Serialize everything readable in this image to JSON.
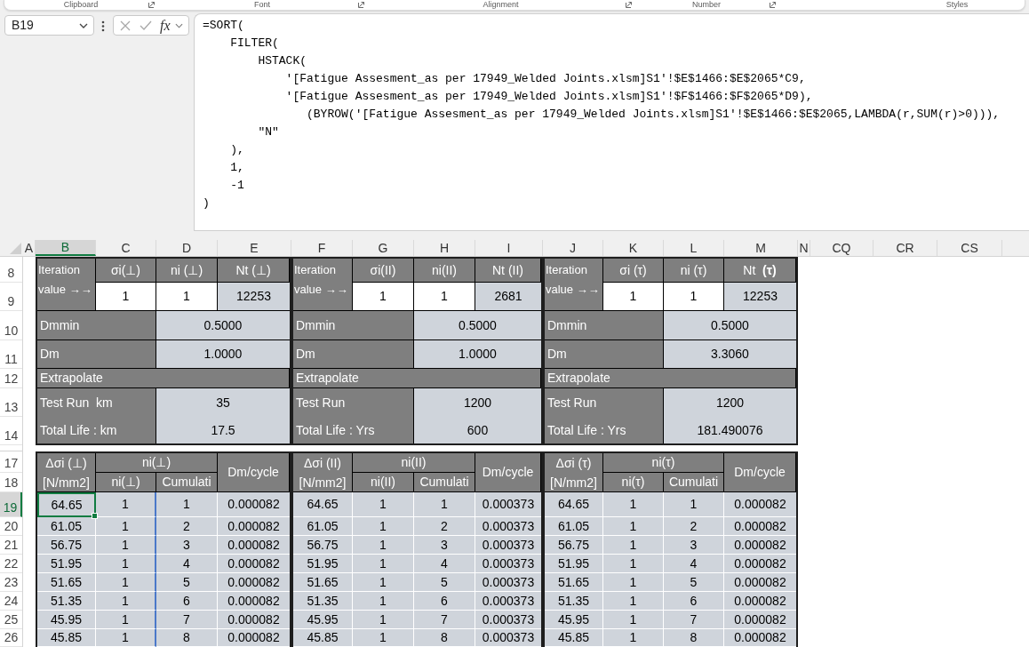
{
  "ribbon": {
    "groups": [
      {
        "label": "Clipboard",
        "launcher": true
      },
      {
        "label": "Font",
        "launcher": true
      },
      {
        "label": "Alignment",
        "launcher": true
      },
      {
        "label": "Number",
        "launcher": true
      },
      {
        "label": "Styles",
        "launcher": false
      }
    ]
  },
  "formula_bar": {
    "name_box": "B19",
    "function_button": "fx",
    "formula_lines": [
      "=SORT(",
      "    FILTER(",
      "        HSTACK(",
      "            '[Fatigue Assesment_as per 17949_Welded Joints.xlsm]S1'!$E$1466:$E$2065*C9,",
      "            '[Fatigue Assesment_as per 17949_Welded Joints.xlsm]S1'!$F$1466:$F$2065*D9),",
      "               (BYROW('[Fatigue Assesment_as per 17949_Welded Joints.xlsm]S1'!$E$1466:$E$2065,LAMBDA(r,SUM(r)>0))),",
      "        \"N\"",
      "    ),",
      "    1,",
      "    -1",
      ")"
    ]
  },
  "column_headers": [
    {
      "label": "A",
      "selected": false
    },
    {
      "label": "B",
      "selected": true
    },
    {
      "label": "C",
      "selected": false
    },
    {
      "label": "D",
      "selected": false
    },
    {
      "label": "E",
      "selected": false
    },
    {
      "label": "F",
      "selected": false
    },
    {
      "label": "G",
      "selected": false
    },
    {
      "label": "H",
      "selected": false
    },
    {
      "label": "I",
      "selected": false
    },
    {
      "label": "J",
      "selected": false
    },
    {
      "label": "K",
      "selected": false
    },
    {
      "label": "L",
      "selected": false
    },
    {
      "label": "M",
      "selected": false
    },
    {
      "label": "N",
      "selected": false
    },
    {
      "label": "CQ",
      "selected": false
    },
    {
      "label": "CR",
      "selected": false
    },
    {
      "label": "CS",
      "selected": false
    }
  ],
  "row_headers": [
    {
      "label": "8",
      "selected": false
    },
    {
      "label": "9",
      "selected": false
    },
    {
      "label": "10",
      "selected": false
    },
    {
      "label": "11",
      "selected": false
    },
    {
      "label": "12",
      "selected": false
    },
    {
      "label": "13",
      "selected": false
    },
    {
      "label": "14",
      "selected": false
    },
    {
      "label": "17",
      "selected": false
    },
    {
      "label": "18",
      "selected": false
    },
    {
      "label": "19",
      "selected": true
    },
    {
      "label": "20",
      "selected": false
    },
    {
      "label": "21",
      "selected": false
    },
    {
      "label": "22",
      "selected": false
    },
    {
      "label": "23",
      "selected": false
    },
    {
      "label": "24",
      "selected": false
    },
    {
      "label": "25",
      "selected": false
    },
    {
      "label": "26",
      "selected": false
    }
  ],
  "summary_blocks": [
    {
      "iteration_label": "Iteration value →→",
      "headers": [
        "σi(⊥)",
        "ni (⊥)",
        "Nt (⊥)"
      ],
      "inputs": [
        "1",
        "1"
      ],
      "result": "12253",
      "damage_rows": [
        {
          "label": "Dmmin",
          "value": "0.5000"
        },
        {
          "label": "Dm",
          "value": "1.0000"
        }
      ],
      "section_label": "Extrapolate",
      "extrapolation_rows": [
        {
          "label": "Test Run  km",
          "value": "35"
        },
        {
          "label": "Total Life : km",
          "value": "17.5"
        }
      ]
    },
    {
      "iteration_label": "Iteration value →→",
      "headers": [
        "σi(II)",
        "ni(II)",
        "Nt (II)"
      ],
      "inputs": [
        "1",
        "1"
      ],
      "result": "2681",
      "damage_rows": [
        {
          "label": "Dmmin",
          "value": "0.5000"
        },
        {
          "label": "Dm",
          "value": "1.0000"
        }
      ],
      "section_label": "Extrapolate",
      "extrapolation_rows": [
        {
          "label": "Test Run",
          "value": "1200"
        },
        {
          "label": "Total Life : Yrs",
          "value": "600"
        }
      ]
    },
    {
      "iteration_label": "Iteration value →→",
      "headers": [
        "σi (τ)",
        "ni (τ)",
        "Nt  **(τ)**"
      ],
      "inputs": [
        "1",
        "1"
      ],
      "result": "12253",
      "damage_rows": [
        {
          "label": "Dmmin",
          "value": "0.5000"
        },
        {
          "label": "Dm",
          "value": "3.3060"
        }
      ],
      "section_label": "Extrapolate",
      "extrapolation_rows": [
        {
          "label": "Test Run",
          "value": "1200"
        },
        {
          "label": "Total Life : Yrs",
          "value": "181.490076"
        }
      ]
    }
  ],
  "cycle_tables": [
    {
      "value_header": "Δσi (⊥) [N/mm2]",
      "count_header": "ni(⊥)",
      "sub_headers": [
        "ni(⊥)",
        "Cumulati"
      ],
      "damage_header": "Dm/cycle",
      "spill_range": true,
      "rows": [
        [
          {
            "text": "64.65",
            "selected": true
          },
          {
            "text": "1",
            "selected": false
          },
          {
            "text": "1",
            "selected": false
          },
          {
            "text": "0.000082",
            "selected": false
          }
        ],
        [
          {
            "text": "61.05",
            "selected": false
          },
          {
            "text": "1",
            "selected": false
          },
          {
            "text": "2",
            "selected": false
          },
          {
            "text": "0.000082",
            "selected": false
          }
        ],
        [
          {
            "text": "56.75",
            "selected": false
          },
          {
            "text": "1",
            "selected": false
          },
          {
            "text": "3",
            "selected": false
          },
          {
            "text": "0.000082",
            "selected": false
          }
        ],
        [
          {
            "text": "51.95",
            "selected": false
          },
          {
            "text": "1",
            "selected": false
          },
          {
            "text": "4",
            "selected": false
          },
          {
            "text": "0.000082",
            "selected": false
          }
        ],
        [
          {
            "text": "51.65",
            "selected": false
          },
          {
            "text": "1",
            "selected": false
          },
          {
            "text": "5",
            "selected": false
          },
          {
            "text": "0.000082",
            "selected": false
          }
        ],
        [
          {
            "text": "51.35",
            "selected": false
          },
          {
            "text": "1",
            "selected": false
          },
          {
            "text": "6",
            "selected": false
          },
          {
            "text": "0.000082",
            "selected": false
          }
        ],
        [
          {
            "text": "45.95",
            "selected": false
          },
          {
            "text": "1",
            "selected": false
          },
          {
            "text": "7",
            "selected": false
          },
          {
            "text": "0.000082",
            "selected": false
          }
        ],
        [
          {
            "text": "45.85",
            "selected": false
          },
          {
            "text": "1",
            "selected": false
          },
          {
            "text": "8",
            "selected": false
          },
          {
            "text": "0.000082",
            "selected": false
          }
        ]
      ]
    },
    {
      "value_header": "Δσi (II) [N/mm2]",
      "count_header": "ni(II)",
      "sub_headers": [
        "ni(II)",
        "Cumulati"
      ],
      "damage_header": "Dm/cycle",
      "spill_range": false,
      "rows": [
        [
          {
            "text": "64.65",
            "selected": false
          },
          {
            "text": "1",
            "selected": false
          },
          {
            "text": "1",
            "selected": false
          },
          {
            "text": "0.000373",
            "selected": false
          }
        ],
        [
          {
            "text": "61.05",
            "selected": false
          },
          {
            "text": "1",
            "selected": false
          },
          {
            "text": "2",
            "selected": false
          },
          {
            "text": "0.000373",
            "selected": false
          }
        ],
        [
          {
            "text": "56.75",
            "selected": false
          },
          {
            "text": "1",
            "selected": false
          },
          {
            "text": "3",
            "selected": false
          },
          {
            "text": "0.000373",
            "selected": false
          }
        ],
        [
          {
            "text": "51.95",
            "selected": false
          },
          {
            "text": "1",
            "selected": false
          },
          {
            "text": "4",
            "selected": false
          },
          {
            "text": "0.000373",
            "selected": false
          }
        ],
        [
          {
            "text": "51.65",
            "selected": false
          },
          {
            "text": "1",
            "selected": false
          },
          {
            "text": "5",
            "selected": false
          },
          {
            "text": "0.000373",
            "selected": false
          }
        ],
        [
          {
            "text": "51.35",
            "selected": false
          },
          {
            "text": "1",
            "selected": false
          },
          {
            "text": "6",
            "selected": false
          },
          {
            "text": "0.000373",
            "selected": false
          }
        ],
        [
          {
            "text": "45.95",
            "selected": false
          },
          {
            "text": "1",
            "selected": false
          },
          {
            "text": "7",
            "selected": false
          },
          {
            "text": "0.000373",
            "selected": false
          }
        ],
        [
          {
            "text": "45.85",
            "selected": false
          },
          {
            "text": "1",
            "selected": false
          },
          {
            "text": "8",
            "selected": false
          },
          {
            "text": "0.000373",
            "selected": false
          }
        ]
      ]
    },
    {
      "value_header": "Δσi (τ) [N/mm2]",
      "count_header": "ni(τ)",
      "sub_headers": [
        "ni(τ)",
        "Cumulati"
      ],
      "damage_header": "Dm/cycle",
      "spill_range": false,
      "rows": [
        [
          {
            "text": "64.65",
            "selected": false
          },
          {
            "text": "1",
            "selected": false
          },
          {
            "text": "1",
            "selected": false
          },
          {
            "text": "0.000082",
            "selected": false
          }
        ],
        [
          {
            "text": "61.05",
            "selected": false
          },
          {
            "text": "1",
            "selected": false
          },
          {
            "text": "2",
            "selected": false
          },
          {
            "text": "0.000082",
            "selected": false
          }
        ],
        [
          {
            "text": "56.75",
            "selected": false
          },
          {
            "text": "1",
            "selected": false
          },
          {
            "text": "3",
            "selected": false
          },
          {
            "text": "0.000082",
            "selected": false
          }
        ],
        [
          {
            "text": "51.95",
            "selected": false
          },
          {
            "text": "1",
            "selected": false
          },
          {
            "text": "4",
            "selected": false
          },
          {
            "text": "0.000082",
            "selected": false
          }
        ],
        [
          {
            "text": "51.65",
            "selected": false
          },
          {
            "text": "1",
            "selected": false
          },
          {
            "text": "5",
            "selected": false
          },
          {
            "text": "0.000082",
            "selected": false
          }
        ],
        [
          {
            "text": "51.35",
            "selected": false
          },
          {
            "text": "1",
            "selected": false
          },
          {
            "text": "6",
            "selected": false
          },
          {
            "text": "0.000082",
            "selected": false
          }
        ],
        [
          {
            "text": "45.95",
            "selected": false
          },
          {
            "text": "1",
            "selected": false
          },
          {
            "text": "7",
            "selected": false
          },
          {
            "text": "0.000082",
            "selected": false
          }
        ],
        [
          {
            "text": "45.85",
            "selected": false
          },
          {
            "text": "1",
            "selected": false
          },
          {
            "text": "8",
            "selected": false
          },
          {
            "text": "0.000082",
            "selected": false
          }
        ]
      ]
    }
  ]
}
